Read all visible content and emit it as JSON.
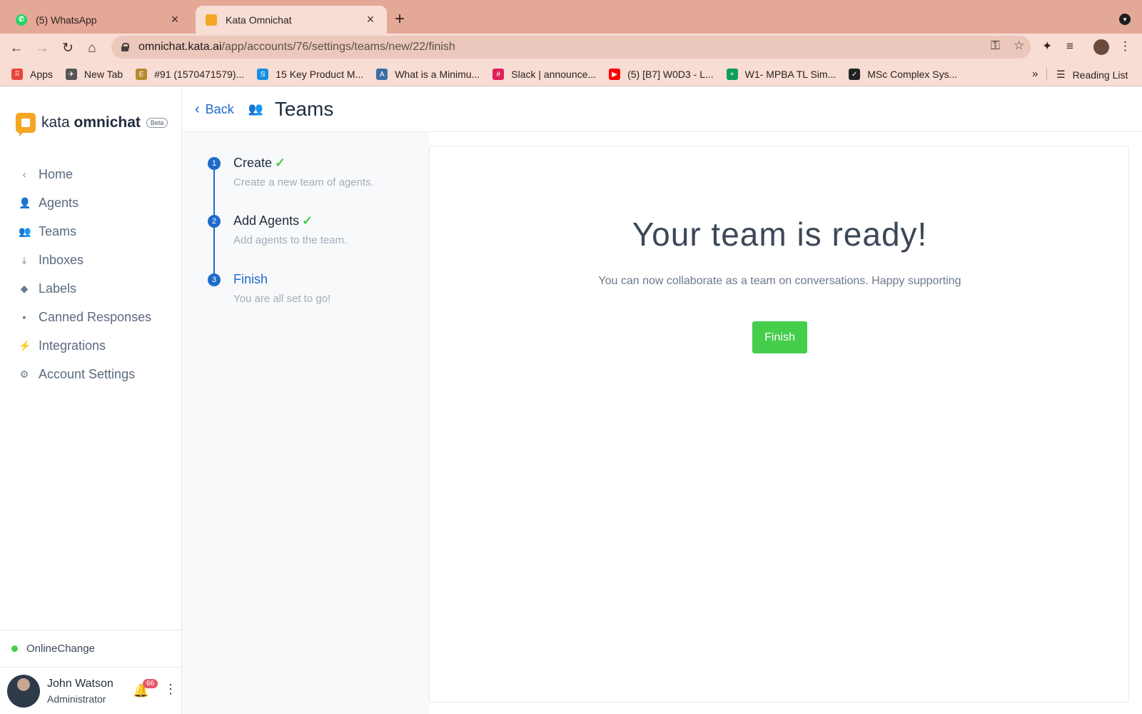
{
  "browser": {
    "tabs": [
      {
        "title": "(5) WhatsApp",
        "active": false,
        "icon": "whatsapp-icon"
      },
      {
        "title": "Kata Omnichat",
        "active": true,
        "icon": "kata-icon"
      }
    ],
    "url_host": "omnichat.kata.ai",
    "url_path": "/app/accounts/76/settings/teams/new/22/finish",
    "bookmarks": [
      {
        "label": "Apps",
        "icon": "apps-grid-icon",
        "color": "#e8453c"
      },
      {
        "label": "New Tab",
        "icon": "new-tab-icon",
        "color": "#555555"
      },
      {
        "label": "#91 (1570471579)...",
        "icon": "bookmark-icon",
        "color": "#b58a2e"
      },
      {
        "label": "15 Key Product M...",
        "icon": "bookmark-icon",
        "color": "#1a8fe3"
      },
      {
        "label": "What is a Minimu...",
        "icon": "bookmark-icon",
        "color": "#3a6ea5"
      },
      {
        "label": "Slack | announce...",
        "icon": "slack-icon",
        "color": "#e01e5a"
      },
      {
        "label": "(5) [B7] W0D3 - L...",
        "icon": "youtube-icon",
        "color": "#ff0000"
      },
      {
        "label": "W1- MPBA TL Sim...",
        "icon": "sheets-icon",
        "color": "#0f9d58"
      },
      {
        "label": "MSc Complex Sys...",
        "icon": "bookmark-icon",
        "color": "#222222"
      }
    ],
    "bookmark_overflow": "»",
    "reading_list": "Reading List"
  },
  "app": {
    "brand_light": "kata",
    "brand_bold": "omnichat",
    "beta": "Beta",
    "menu": [
      {
        "label": "Home",
        "icon": "chevron-left-icon"
      },
      {
        "label": "Agents",
        "icon": "agents-icon"
      },
      {
        "label": "Teams",
        "icon": "teams-icon"
      },
      {
        "label": "Inboxes",
        "icon": "inbox-icon"
      },
      {
        "label": "Labels",
        "icon": "label-icon"
      },
      {
        "label": "Canned Responses",
        "icon": "chat-icon"
      },
      {
        "label": "Integrations",
        "icon": "bolt-icon"
      },
      {
        "label": "Account Settings",
        "icon": "gear-icon"
      }
    ],
    "status": {
      "label": "Online",
      "change": "Change",
      "color": "#44ce4b"
    },
    "user": {
      "name": "John Watson",
      "role": "Administrator",
      "notifications": "66"
    },
    "header": {
      "back": "Back",
      "title": "Teams"
    },
    "steps": [
      {
        "num": "1",
        "title": "Create",
        "desc": "Create a new team of agents.",
        "done": true
      },
      {
        "num": "2",
        "title": "Add Agents",
        "desc": "Add agents to the team.",
        "done": true
      },
      {
        "num": "3",
        "title": "Finish",
        "desc": "You are all set to go!",
        "done": false
      }
    ],
    "main": {
      "title": "Your team is ready!",
      "subtitle": "You can now collaborate as a team on conversations. Happy supporting",
      "button": "Finish"
    },
    "colors": {
      "accent": "#1f6bc9",
      "success": "#44ce4b",
      "brand": "#f5a623"
    }
  }
}
